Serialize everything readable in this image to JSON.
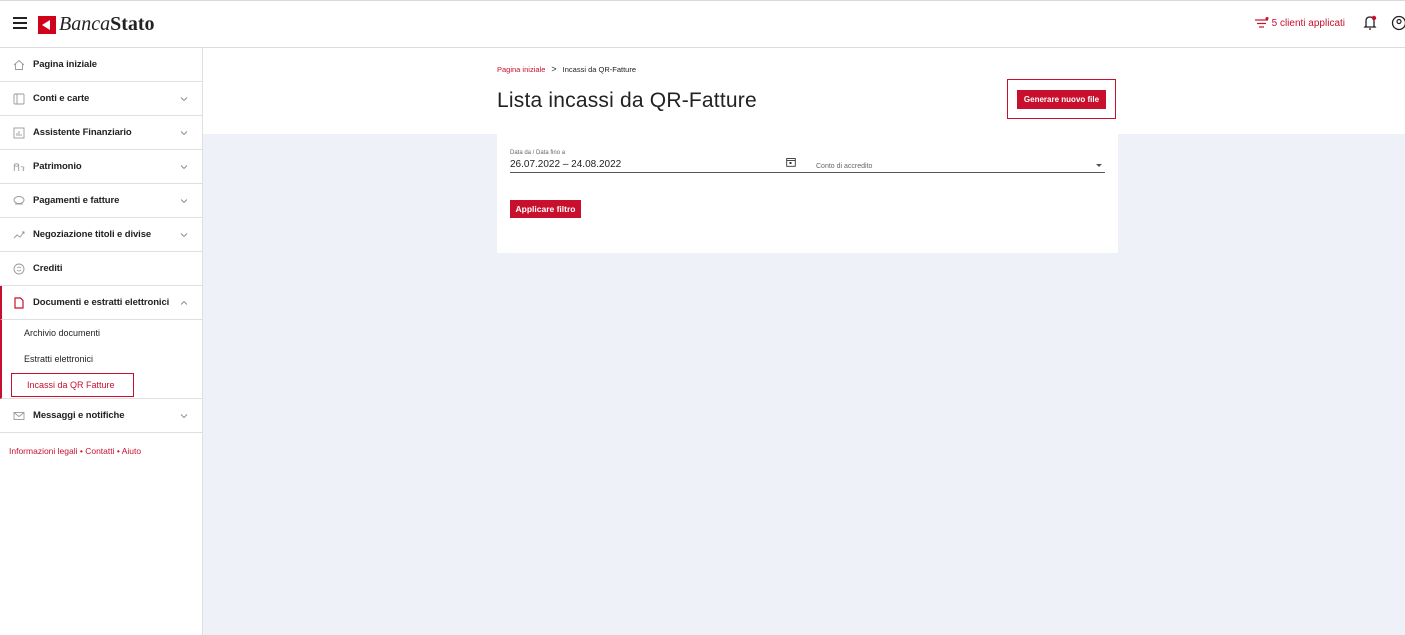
{
  "header": {
    "logo_text_a": "Banca",
    "logo_text_b": "Stato",
    "clients_filter_label": "5 clienti applicati"
  },
  "sidebar": {
    "items": [
      {
        "label": "Pagina iniziale",
        "icon": "home-icon"
      },
      {
        "label": "Conti e carte",
        "icon": "card-icon"
      },
      {
        "label": "Assistente Finanziario",
        "icon": "chart-icon"
      },
      {
        "label": "Patrimonio",
        "icon": "coins-icon"
      },
      {
        "label": "Pagamenti e fatture",
        "icon": "payments-icon"
      },
      {
        "label": "Negoziazione titoli e divise",
        "icon": "trend-icon"
      },
      {
        "label": "Crediti",
        "icon": "credit-icon"
      },
      {
        "label": "Documenti e estratti elettronici",
        "icon": "document-icon"
      },
      {
        "label": "Messaggi e notifiche",
        "icon": "mail-icon"
      }
    ],
    "sub_items": [
      {
        "label": "Archivio documenti"
      },
      {
        "label": "Estratti elettronici"
      },
      {
        "label": "Incassi da QR Fatture"
      }
    ],
    "footer": {
      "legal": "Informazioni legali",
      "sep": " • ",
      "contacts": "Contatti",
      "help": "Aiuto"
    }
  },
  "main": {
    "breadcrumb": {
      "home": "Pagina iniziale",
      "sep": ">",
      "current": "Incassi da QR-Fatture"
    },
    "title": "Lista incassi da QR-Fatture",
    "generate_button": "Generare nuovo file",
    "filter": {
      "date_label": "Data da / Data fino a",
      "date_value": "26.07.2022 – 24.08.2022",
      "account_placeholder": "Conto di accredito",
      "apply_button": "Applicare filtro"
    }
  },
  "colors": {
    "accent": "#c8102e",
    "background": "#eef1f8"
  }
}
